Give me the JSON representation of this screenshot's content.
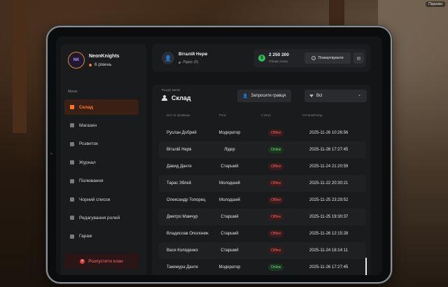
{
  "sidebar": {
    "clan_name": "NeonKnights",
    "clan_level": "6 рівень",
    "avatar_text": "NK",
    "menu_label": "Меню",
    "items": [
      {
        "label": "Склад",
        "icon": "people-icon",
        "active": true
      },
      {
        "label": "Магазин",
        "icon": "shop-icon",
        "active": false
      },
      {
        "label": "Розвиток",
        "icon": "chart-icon",
        "active": false
      },
      {
        "label": "Журнал",
        "icon": "book-icon",
        "active": false
      },
      {
        "label": "Полювання",
        "icon": "hunt-icon",
        "active": false
      },
      {
        "label": "Чорний список",
        "icon": "blacklist-icon",
        "active": false
      },
      {
        "label": "Редагування ролей",
        "icon": "role-icon",
        "active": false
      },
      {
        "label": "Гараж",
        "icon": "car-icon",
        "active": false
      }
    ],
    "disband_label": "Розпустити клан"
  },
  "user": {
    "name": "Віталій Нерв",
    "role": "Лідер (5)"
  },
  "treasury": {
    "amount": "2 250 200",
    "label": "Общак клану",
    "coin_symbol": "$",
    "donate_label": "Пожертвувати"
  },
  "main": {
    "caption": "Розділ меню",
    "title": "Склад",
    "invite_label": "Запросити гравця",
    "filter_value": "Всі",
    "columns": {
      "name": "Ім'я та прізвище",
      "role": "Роль",
      "status": "Статус",
      "last": "Останній вхід"
    },
    "rows": [
      {
        "name": "Руслан Добрий",
        "role": "Модератор",
        "status": "Offline",
        "last": "2025-11-26 10:26:56"
      },
      {
        "name": "Віталій Нерв",
        "role": "Лідер",
        "status": "Online",
        "last": "2025-11-26 17:27:45"
      },
      {
        "name": "Давид Данте",
        "role": "Старший",
        "status": "Offline",
        "last": "2025-11-24 21:20:59"
      },
      {
        "name": "Тарас Зблей",
        "role": "Молодший",
        "status": "Offline",
        "last": "2025-11-22 20:30:21"
      },
      {
        "name": "Олександр Топорец",
        "role": "Молодший",
        "status": "Offline",
        "last": "2025-11-25 23:29:52"
      },
      {
        "name": "Дмитро Мамчур",
        "role": "Старший",
        "status": "Offline",
        "last": "2025-11-25 19:30:37"
      },
      {
        "name": "Владислав Ополоник",
        "role": "Старший",
        "status": "Offline",
        "last": "2025-11-26 12:15:28"
      },
      {
        "name": "Вася Коляденко",
        "role": "Старший",
        "status": "Offline",
        "last": "2025-11-24 18:14:11"
      },
      {
        "name": "Такемура Данте",
        "role": "Модератор",
        "status": "Online",
        "last": "2025-11-26 17:27:45"
      }
    ]
  },
  "background": {
    "hint": "Підказки"
  },
  "colors": {
    "accent": "#ff7a2a",
    "offline": "#ff5a5a",
    "online": "#6ae07a",
    "money": "#2ebd5a"
  }
}
